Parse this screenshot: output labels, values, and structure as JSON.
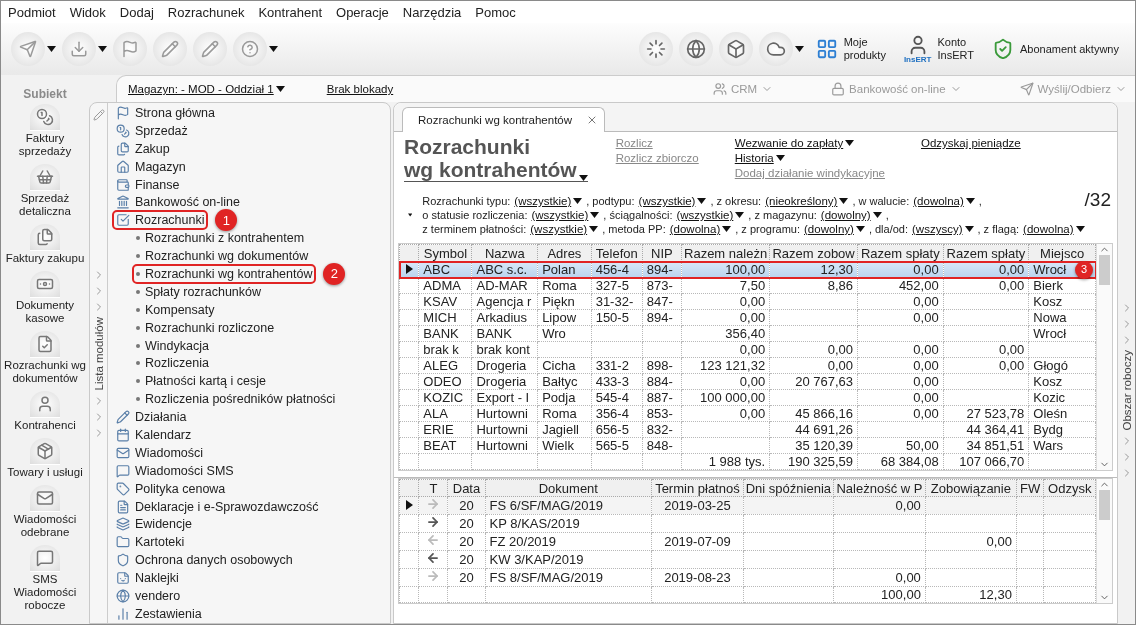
{
  "menu": [
    "Podmiot",
    "Widok",
    "Dodaj",
    "Rozrachunek",
    "Kontrahent",
    "Operacje",
    "Narzędzia",
    "Pomoc"
  ],
  "toolbar": {
    "left_buttons": [
      {
        "dropdown": true
      },
      {
        "dropdown": true
      },
      {
        "dropdown": false
      },
      {
        "dropdown": false
      },
      {
        "dropdown": false
      },
      {
        "dropdown": true
      }
    ],
    "right_icons": [
      {
        "dropdown": false
      },
      {
        "dropdown": false
      },
      {
        "dropdown": false
      },
      {
        "dropdown": true
      }
    ],
    "right_items": [
      {
        "kind": "products",
        "label": "Moje\nprodukty"
      },
      {
        "kind": "account",
        "label": "Konto\nInsERT",
        "badge": "InsERT"
      },
      {
        "kind": "subscription",
        "label": "Abonament aktywny"
      }
    ]
  },
  "app_label": "Subiekt",
  "subbar": {
    "warehouse": "Magazyn: - MOD - Oddział 1",
    "lock": "Brak blokady",
    "buttons": [
      {
        "kind": "crm",
        "label": "CRM"
      },
      {
        "kind": "bank",
        "label": "Bankowość on-line"
      },
      {
        "kind": "send",
        "label": "Wyślij/Odbierz"
      }
    ]
  },
  "shortcuts": [
    {
      "label": "Faktury\nsprzedaży"
    },
    {
      "label": "Sprzedaż\ndetaliczna"
    },
    {
      "label": "Faktury zakupu"
    },
    {
      "label": "Dokumenty\nkasowe"
    },
    {
      "label": "Rozrachunki wg\ndokumentów"
    },
    {
      "label": "Kontrahenci"
    },
    {
      "label": "Towary i usługi"
    },
    {
      "label": "Wiadomości\nodebrane"
    },
    {
      "label": "SMS\nWiadomości\nrobocze"
    }
  ],
  "modules": {
    "title": "Lista modułów",
    "items": [
      {
        "label": "Strona główna",
        "highlighted": false
      },
      {
        "label": "Sprzedaż",
        "highlighted": false
      },
      {
        "label": "Zakup",
        "highlighted": false
      },
      {
        "label": "Magazyn",
        "highlighted": false
      },
      {
        "label": "Finanse",
        "highlighted": false
      },
      {
        "label": "Bankowość on-line",
        "highlighted": false
      },
      {
        "label": "Rozrachunki",
        "highlighted": true,
        "callout": "1",
        "children": [
          {
            "label": "Rozrachunki z kontrahentem",
            "highlighted": false
          },
          {
            "label": "Rozrachunki wg dokumentów",
            "highlighted": false
          },
          {
            "label": "Rozrachunki wg kontrahentów",
            "highlighted": true,
            "callout": "2"
          },
          {
            "label": "Spłaty rozrachunków",
            "highlighted": false
          },
          {
            "label": "Kompensaty",
            "highlighted": false
          },
          {
            "label": "Rozrachunki rozliczone",
            "highlighted": false
          },
          {
            "label": "Windykacja",
            "highlighted": false
          },
          {
            "label": "Rozliczenia",
            "highlighted": false
          },
          {
            "label": "Płatności kartą i cesje",
            "highlighted": false
          },
          {
            "label": "Rozliczenia pośredników płatności",
            "highlighted": false
          }
        ]
      },
      {
        "label": "Działania",
        "highlighted": false
      },
      {
        "label": "Kalendarz",
        "highlighted": false
      },
      {
        "label": "Wiadomości",
        "highlighted": false
      },
      {
        "label": "Wiadomości SMS",
        "highlighted": false
      },
      {
        "label": "Polityka cenowa",
        "highlighted": false
      },
      {
        "label": "Deklaracje i e-Sprawozdawczość",
        "highlighted": false
      },
      {
        "label": "Ewidencje",
        "highlighted": false
      },
      {
        "label": "Kartoteki",
        "highlighted": false
      },
      {
        "label": "Ochrona danych osobowych",
        "highlighted": false
      },
      {
        "label": "Naklejki",
        "highlighted": false
      },
      {
        "label": "vendero",
        "highlighted": false
      },
      {
        "label": "Zestawienia",
        "highlighted": false
      }
    ]
  },
  "tab": {
    "label": "Rozrachunki wg kontrahentów"
  },
  "title": "Rozrachunki\nwg kontrahentów",
  "action_columns": [
    [
      {
        "label": "Rozlicz",
        "disabled": true,
        "dropdown": false
      },
      {
        "label": "Rozlicz zbiorczo",
        "disabled": true,
        "dropdown": false
      }
    ],
    [
      {
        "label": "Wezwanie do zapłaty",
        "disabled": false,
        "dropdown": true
      },
      {
        "label": "Historia",
        "disabled": false,
        "dropdown": true
      },
      {
        "label": "Dodaj działanie windykacyjne",
        "disabled": true,
        "dropdown": false
      }
    ],
    [
      {
        "label": "Odzyskaj pieniądze",
        "disabled": false,
        "dropdown": false
      }
    ]
  ],
  "filters": [
    {
      "items": [
        {
          "label": "Rozrachunki typu:",
          "value": "(wszystkie)"
        },
        {
          "label": ", podtypu:",
          "value": "(wszystkie)"
        },
        {
          "label": ", z okresu:",
          "value": "(nieokreślony)"
        },
        {
          "label": ", w walucie:",
          "value": "(dowolna)"
        }
      ],
      "trailing": ","
    },
    {
      "items": [
        {
          "label": "o statusie rozliczenia:",
          "value": "(wszystkie)"
        },
        {
          "label": ", ściągalności:",
          "value": "(wszystkie)"
        },
        {
          "label": ", z magazynu:",
          "value": "(dowolny)"
        }
      ],
      "trailing": ","
    },
    {
      "items": [
        {
          "label": "z terminem płatności:",
          "value": "(wszystkie)"
        },
        {
          "label": ", metoda PP:",
          "value": "(dowolna)"
        },
        {
          "label": ", z programu:",
          "value": "(dowolny)"
        },
        {
          "label": ", dla/od:",
          "value": "(wszyscy)"
        },
        {
          "label": ", z flagą:",
          "value": "(dowolna)"
        }
      ]
    }
  ],
  "count": "/32",
  "top_table": {
    "columns": [
      "Symbol",
      "Nazwa",
      "Adres",
      "Telefon",
      "NIP",
      "Razem należn",
      "Razem zobow",
      "Razem spłaty",
      "Razem spłaty",
      "Miejsco"
    ],
    "rows": [
      {
        "selected": true,
        "highlighted": true,
        "callout": "3",
        "cells": [
          "ABC",
          "ABC s.c.",
          "Polan",
          "456-4",
          "894-",
          "100,00",
          "12,30",
          "0,00",
          "0,00",
          "Wrocł"
        ]
      },
      {
        "selected": false,
        "highlighted": false,
        "cells": [
          "ADMA",
          "AD-MAR",
          "Roma",
          "327-5",
          "873-",
          "7,50",
          "8,86",
          "452,00",
          "0,00",
          "Bierk"
        ]
      },
      {
        "selected": false,
        "highlighted": false,
        "cells": [
          "KSAV",
          "Agencja r",
          "Piękn",
          "31-32-",
          "847-",
          "0,00",
          {
            "kind": "blank"
          },
          "0,00",
          {
            "kind": "blank"
          },
          "Kosz"
        ]
      },
      {
        "selected": false,
        "highlighted": false,
        "cells": [
          "MICH",
          "Arkadius",
          "Lipow",
          "150-5",
          "894-",
          "0,00",
          {
            "kind": "blank"
          },
          "0,00",
          {
            "kind": "blank"
          },
          "Nowa"
        ]
      },
      {
        "selected": false,
        "highlighted": false,
        "cells": [
          "BANK",
          "BANK",
          "Wro",
          {
            "kind": "blank"
          },
          {
            "kind": "blank"
          },
          "356,40",
          {
            "kind": "blank"
          },
          {
            "kind": "blank"
          },
          {
            "kind": "blank"
          },
          "Wrocł"
        ]
      },
      {
        "selected": false,
        "highlighted": false,
        "cells": [
          "brak k",
          "brak kont",
          {
            "kind": "blank"
          },
          {
            "kind": "blank"
          },
          {
            "kind": "blank"
          },
          "0,00",
          "0,00",
          "0,00",
          "0,00"
        ]
      },
      {
        "selected": false,
        "highlighted": false,
        "cells": [
          "ALEG",
          "Drogeria",
          "Cicha",
          "331-2",
          "898-",
          "123 121,32",
          "0,00",
          "0,00",
          "0,00",
          "Głogó"
        ]
      },
      {
        "selected": false,
        "highlighted": false,
        "cells": [
          "ODEO",
          "Drogeria",
          "Bałtyc",
          "433-3",
          "884-",
          "0,00",
          "20 767,63",
          "0,00",
          {
            "kind": "blank"
          },
          "Kosz"
        ]
      },
      {
        "selected": false,
        "highlighted": false,
        "cells": [
          "KOZIC",
          "Export - I",
          "Podja",
          "545-4",
          "887-",
          "100 000,00",
          {
            "kind": "blank"
          },
          "0,00",
          {
            "kind": "blank"
          },
          "Kozic"
        ]
      },
      {
        "selected": false,
        "highlighted": false,
        "cells": [
          "ALA",
          "Hurtowni",
          "Roma",
          "356-4",
          "853-",
          "0,00",
          "45 866,16",
          "0,00",
          "27 523,78",
          "Oleśn"
        ]
      },
      {
        "selected": false,
        "highlighted": false,
        "cells": [
          "ERIE",
          "Hurtowni",
          "Jagiell",
          "656-5",
          "832-",
          {
            "kind": "blank"
          },
          "44 691,26",
          {
            "kind": "blank"
          },
          "44 364,41",
          "Bydg"
        ]
      },
      {
        "selected": false,
        "highlighted": false,
        "cells": [
          "BEAT",
          "Hurtowni",
          "Wielk",
          "565-5",
          "848-",
          {
            "kind": "blank"
          },
          "35 120,39",
          "50,00",
          "34 851,51",
          "Wars"
        ]
      }
    ],
    "totals": [
      {
        "kind": "blank"
      },
      {
        "kind": "blank"
      },
      {
        "kind": "blank"
      },
      {
        "kind": "blank"
      },
      {
        "kind": "blank"
      },
      "1 988 tys.",
      "190 325,59",
      "68 384,08",
      "107 066,70"
    ]
  },
  "bottom_table": {
    "columns": [
      "T",
      "Data",
      "Dokument",
      "Termin płatnoś",
      "Dni spóźnienia",
      "Należność w P",
      "Zobowiązanie",
      "FW",
      "Odzysk"
    ],
    "rows": [
      {
        "selected": true,
        "cells": [
          {
            "kind": "arrow",
            "points_left": false,
            "faded": true
          },
          "20",
          "FS 6/SF/MAG/2019",
          "2019-03-25",
          {
            "kind": "blank"
          },
          "0,00"
        ]
      },
      {
        "selected": false,
        "cells": [
          {
            "kind": "arrow",
            "points_left": false,
            "faded": false
          },
          "20",
          "KP 8/KAS/2019"
        ]
      },
      {
        "selected": false,
        "cells": [
          {
            "kind": "arrow",
            "points_left": true,
            "faded": true
          },
          "20",
          "FZ 20/2019",
          "2019-07-09",
          {
            "kind": "blank"
          },
          {
            "kind": "blank"
          },
          "0,00"
        ]
      },
      {
        "selected": false,
        "cells": [
          {
            "kind": "arrow",
            "points_left": true,
            "faded": false
          },
          "20",
          "KW 3/KAP/2019"
        ]
      },
      {
        "selected": false,
        "cells": [
          {
            "kind": "arrow",
            "points_left": false,
            "faded": true
          },
          "20",
          "FS 8/SF/MAG/2019",
          "2019-08-23",
          {
            "kind": "blank"
          },
          "0,00"
        ]
      }
    ],
    "totals": [
      {
        "kind": "blank"
      },
      {
        "kind": "blank"
      },
      {
        "kind": "blank"
      },
      {
        "kind": "blank"
      },
      {
        "kind": "blank"
      },
      "100,00",
      "12,30"
    ]
  },
  "right_rail": {
    "label": "Obszar roboczy"
  }
}
